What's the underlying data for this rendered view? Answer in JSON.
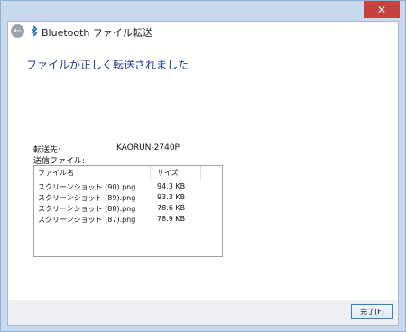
{
  "window": {
    "title": "Bluetooth ファイル転送",
    "close_glyph": "✕",
    "back_glyph": "←"
  },
  "main": {
    "heading": "ファイルが正しく転送されました",
    "destination_label": "転送先:",
    "destination_value": "KAORUN-2740P",
    "sent_files_label": "送信ファイル:"
  },
  "files": {
    "columns": [
      "ファイル名",
      "サイズ"
    ],
    "rows": [
      {
        "name": "スクリーンショット (90).png",
        "size": "94.3 KB"
      },
      {
        "name": "スクリーンショット (89).png",
        "size": "93.3 KB"
      },
      {
        "name": "スクリーンショット (88).png",
        "size": "78.6 KB"
      },
      {
        "name": "スクリーンショット (87).png",
        "size": "78.9 KB"
      }
    ]
  },
  "footer": {
    "finish_label": "完了(F)"
  },
  "colors": {
    "heading": "#1f3d9e",
    "close": "#c7413f",
    "frame": "#c8d8ed"
  },
  "icons": {
    "back": "back-arrow-icon",
    "bluetooth": "bluetooth-icon",
    "close": "close-icon"
  }
}
